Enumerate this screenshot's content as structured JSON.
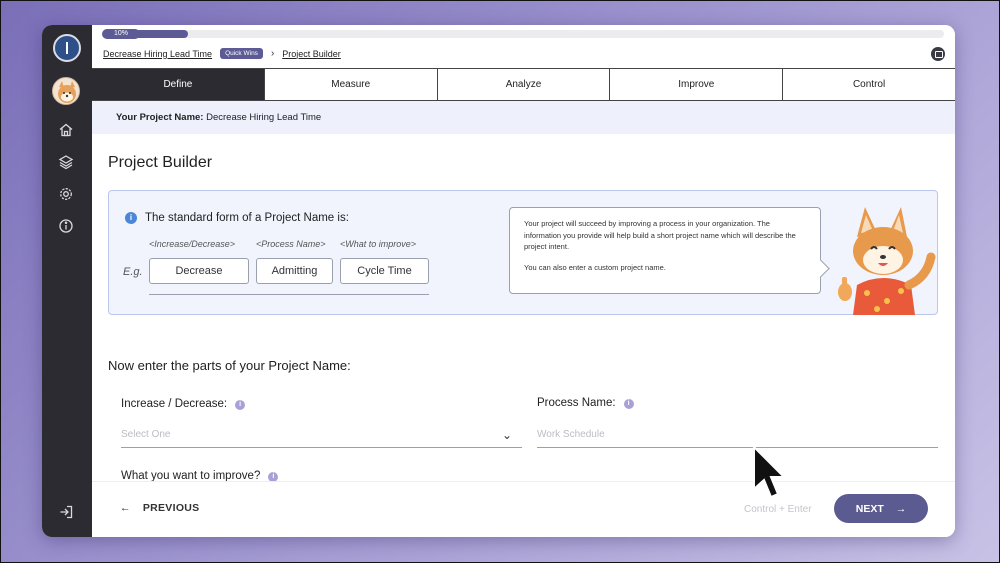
{
  "progress": {
    "label": "10%",
    "value": 0.1
  },
  "breadcrumb": {
    "project": "Decrease Hiring Lead Time",
    "badge": "Quick Wins",
    "current": "Project Builder"
  },
  "tabs": [
    {
      "label": "Define",
      "active": true
    },
    {
      "label": "Measure"
    },
    {
      "label": "Analyze"
    },
    {
      "label": "Improve"
    },
    {
      "label": "Control"
    }
  ],
  "project_name_bar": {
    "label": "Your Project Name:",
    "value": "Decrease Hiring Lead Time"
  },
  "page_title": "Project Builder",
  "info_card": {
    "title": "The standard form of a Project Name is:",
    "hints": [
      "<Increase/Decrease>",
      "<Process Name>",
      "<What to improve>"
    ],
    "eg_label": "E.g.",
    "examples": [
      "Decrease",
      "Admitting",
      "Cycle Time"
    ],
    "bubble_p1": "Your project will succeed by improving a process in your organization. The information you provide will help build a short project name which will describe the project intent.",
    "bubble_p2": "You can also enter a custom project name."
  },
  "parts_title": "Now enter the parts of your Project Name:",
  "fields": {
    "increase": {
      "label": "Increase / Decrease:",
      "placeholder": "Select One"
    },
    "process": {
      "label": "Process Name:",
      "placeholder": "Work Schedule"
    },
    "improve": {
      "label": "What you want to improve?"
    }
  },
  "footer": {
    "previous": "PREVIOUS",
    "shortcut": "Control + Enter",
    "next": "NEXT"
  },
  "colors": {
    "accent": "#5c5b96",
    "sidebar": "#2b2b31",
    "info": "#4c86d6",
    "card_bg": "#f1f4fd"
  }
}
